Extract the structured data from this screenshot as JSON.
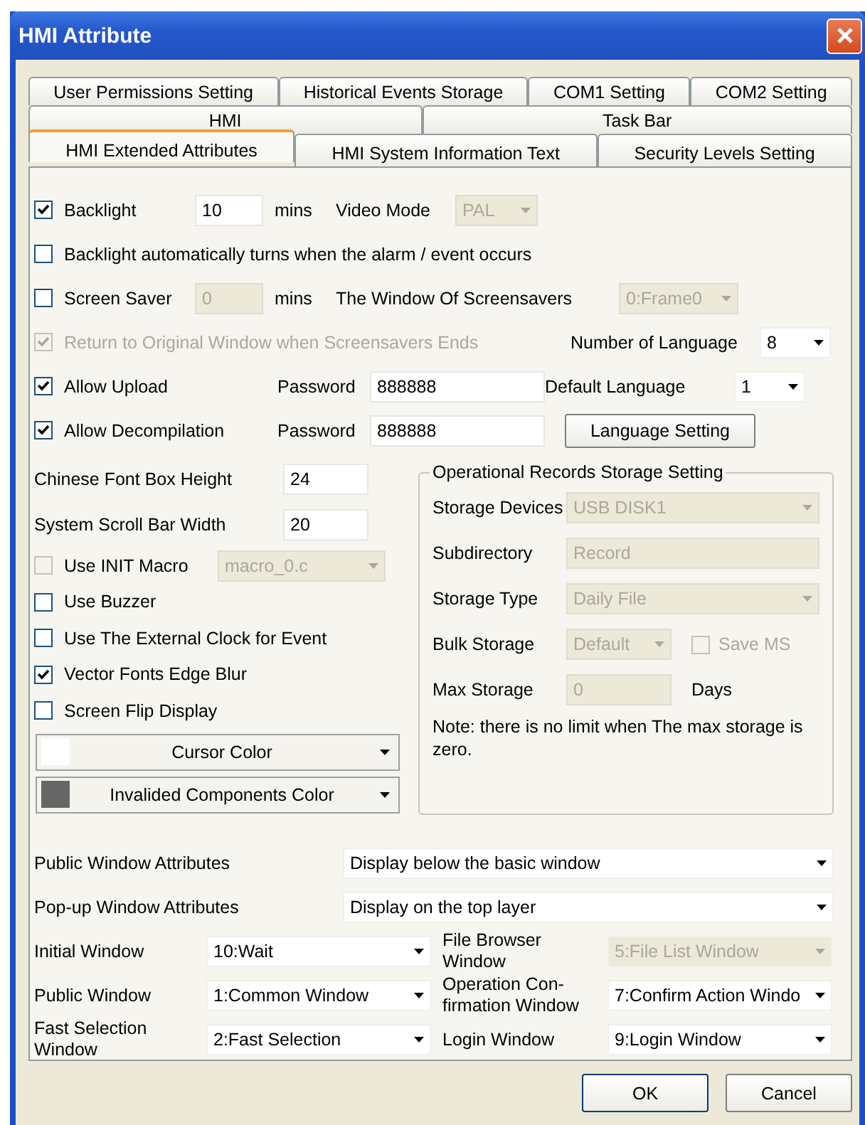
{
  "window": {
    "title": "HMI Attribute"
  },
  "tab_rows": [
    [
      {
        "label": "User Permissions Setting",
        "selected": false
      },
      {
        "label": "Historical Events Storage",
        "selected": false
      },
      {
        "label": "COM1 Setting",
        "selected": false
      },
      {
        "label": "COM2 Setting",
        "selected": false
      }
    ],
    [
      {
        "label": "HMI",
        "selected": false
      },
      {
        "label": "Task Bar",
        "selected": false
      }
    ],
    [
      {
        "label": "HMI Extended Attributes",
        "selected": true
      },
      {
        "label": "HMI System Information Text",
        "selected": false
      },
      {
        "label": "Security Levels Setting",
        "selected": false
      }
    ]
  ],
  "backlight": {
    "label": "Backlight",
    "checked": true,
    "value": "10",
    "unit": "mins"
  },
  "video_mode": {
    "label": "Video Mode",
    "value": "PAL",
    "disabled": true
  },
  "backlight_alarm": {
    "label": "Backlight automatically turns when the alarm / event occurs",
    "checked": false
  },
  "screen_saver": {
    "label": "Screen Saver",
    "checked": false,
    "value": "0",
    "disabled": true,
    "unit": "mins"
  },
  "screensaver_window": {
    "label": "The Window Of Screensavers",
    "value": "0:Frame0",
    "disabled": true
  },
  "return_original": {
    "label": "Return to Original Window when Screensavers Ends",
    "checked": true,
    "disabled": true
  },
  "number_of_language": {
    "label": "Number of Language",
    "value": "8"
  },
  "allow_upload": {
    "label": "Allow Upload",
    "checked": true,
    "password_label": "Password",
    "password": "888888"
  },
  "default_language": {
    "label": "Default Language",
    "value": "1"
  },
  "allow_decompilation": {
    "label": "Allow Decompilation",
    "checked": true,
    "password_label": "Password",
    "password": "888888"
  },
  "language_setting_button": "Language Setting",
  "sizes": [
    {
      "label": "Chinese Font Box Height",
      "value": "24"
    },
    {
      "label": "System Scroll Bar Width",
      "value": "20"
    }
  ],
  "options": [
    {
      "label": "Use INIT Macro",
      "checked": false,
      "kind": "combo",
      "value": "macro_0.c",
      "disabled": true
    },
    {
      "label": "Use Buzzer",
      "checked": false,
      "kind": "plain"
    },
    {
      "label": "Use The External Clock for Event",
      "checked": false,
      "kind": "plain"
    },
    {
      "label": "Vector Fonts Edge Blur",
      "checked": true,
      "kind": "plain"
    },
    {
      "label": "Screen Flip Display",
      "checked": false,
      "kind": "plain"
    }
  ],
  "color_buttons": [
    {
      "label": "Cursor Color",
      "color": "#ffffff"
    },
    {
      "label": "Invalided Components Color",
      "color": "#666666"
    }
  ],
  "storage": {
    "title": "Operational Records Storage Setting",
    "fields": [
      {
        "label": "Storage Devices",
        "kind": "combo",
        "value": "USB DISK1",
        "disabled": true
      },
      {
        "label": "Subdirectory",
        "kind": "text",
        "value": "Record",
        "disabled": true
      },
      {
        "label": "Storage Type",
        "kind": "combo",
        "value": "Daily File",
        "disabled": true
      },
      {
        "label": "Bulk Storage",
        "kind": "combo_check",
        "value": "Default",
        "disabled": true,
        "check_label": "Save MS",
        "checked": false
      },
      {
        "label": "Max Storage",
        "kind": "text_unit",
        "value": "0",
        "disabled": true,
        "unit": "Days"
      }
    ],
    "note": "Note: there is no limit when The max storage is zero."
  },
  "window_attributes": [
    {
      "label": "Public Window Attributes",
      "value": "Display below the basic window"
    },
    {
      "label": "Pop-up Window Attributes",
      "value": "Display on the top layer"
    }
  ],
  "window_selects": [
    {
      "label": "Initial Window",
      "value": "10:Wait",
      "disabled": false
    },
    {
      "label": "File Browser Window",
      "value": "5:File List Window",
      "disabled": true
    },
    {
      "label": "Public Window",
      "value": "1:Common Window",
      "disabled": false
    },
    {
      "label": "Operation Con-firmation Window",
      "value": "7:Confirm Action Windo",
      "disabled": false
    },
    {
      "label": "Fast Selection Window",
      "value": "2:Fast Selection",
      "disabled": false
    },
    {
      "label": "Login Window",
      "value": "9:Login Window",
      "disabled": false
    }
  ],
  "buttons": [
    "OK",
    "Cancel"
  ]
}
